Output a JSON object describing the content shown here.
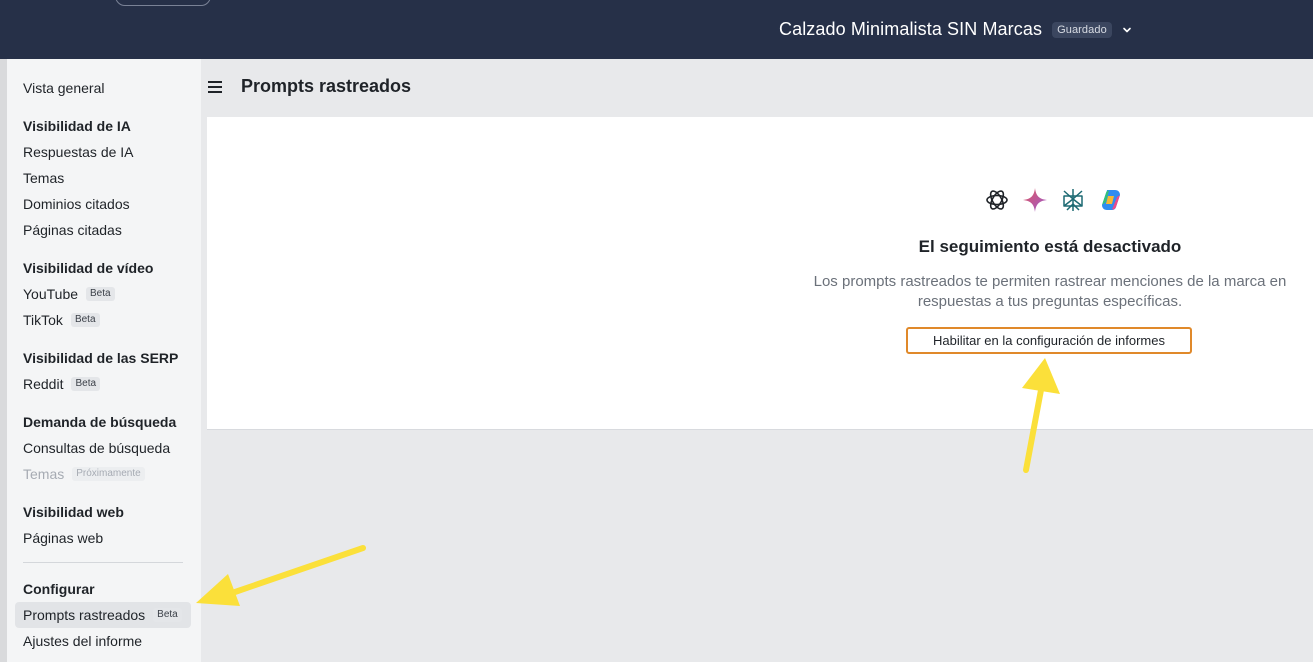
{
  "topbar": {
    "project_name": "Calzado Minimalista SIN Marcas",
    "saved_badge": "Guardado"
  },
  "sidebar": {
    "overview": "Vista general",
    "groups": [
      {
        "heading": "Visibilidad de IA",
        "items": [
          {
            "label": "Respuestas de IA"
          },
          {
            "label": "Temas"
          },
          {
            "label": "Dominios citados"
          },
          {
            "label": "Páginas citadas"
          }
        ]
      },
      {
        "heading": "Visibilidad de vídeo",
        "items": [
          {
            "label": "YouTube",
            "tag": "Beta"
          },
          {
            "label": "TikTok",
            "tag": "Beta"
          }
        ]
      },
      {
        "heading": "Visibilidad de las SERP",
        "items": [
          {
            "label": "Reddit",
            "tag": "Beta"
          }
        ]
      },
      {
        "heading": "Demanda de búsqueda",
        "items": [
          {
            "label": "Consultas de búsqueda"
          },
          {
            "label": "Temas",
            "tag": "Próximamente"
          }
        ]
      },
      {
        "heading": "Visibilidad web",
        "items": [
          {
            "label": "Páginas web"
          }
        ]
      },
      {
        "heading": "Configurar",
        "items": [
          {
            "label": "Prompts rastreados",
            "tag": "Beta"
          },
          {
            "label": "Ajustes del informe"
          }
        ]
      }
    ]
  },
  "main": {
    "title": "Prompts rastreados",
    "empty_state": {
      "title": "El seguimiento está desactivado",
      "description": "Los prompts rastreados te permiten rastrear menciones de la marca en respuestas a tus preguntas específicas.",
      "button_label": "Habilitar en la configuración de informes",
      "icons": [
        "chatgpt-icon",
        "gemini-icon",
        "perplexity-icon",
        "copilot-icon"
      ]
    }
  },
  "colors": {
    "topbar": "#263048",
    "cta_border": "#e0892a",
    "annotation_arrow": "#fbe03a"
  }
}
